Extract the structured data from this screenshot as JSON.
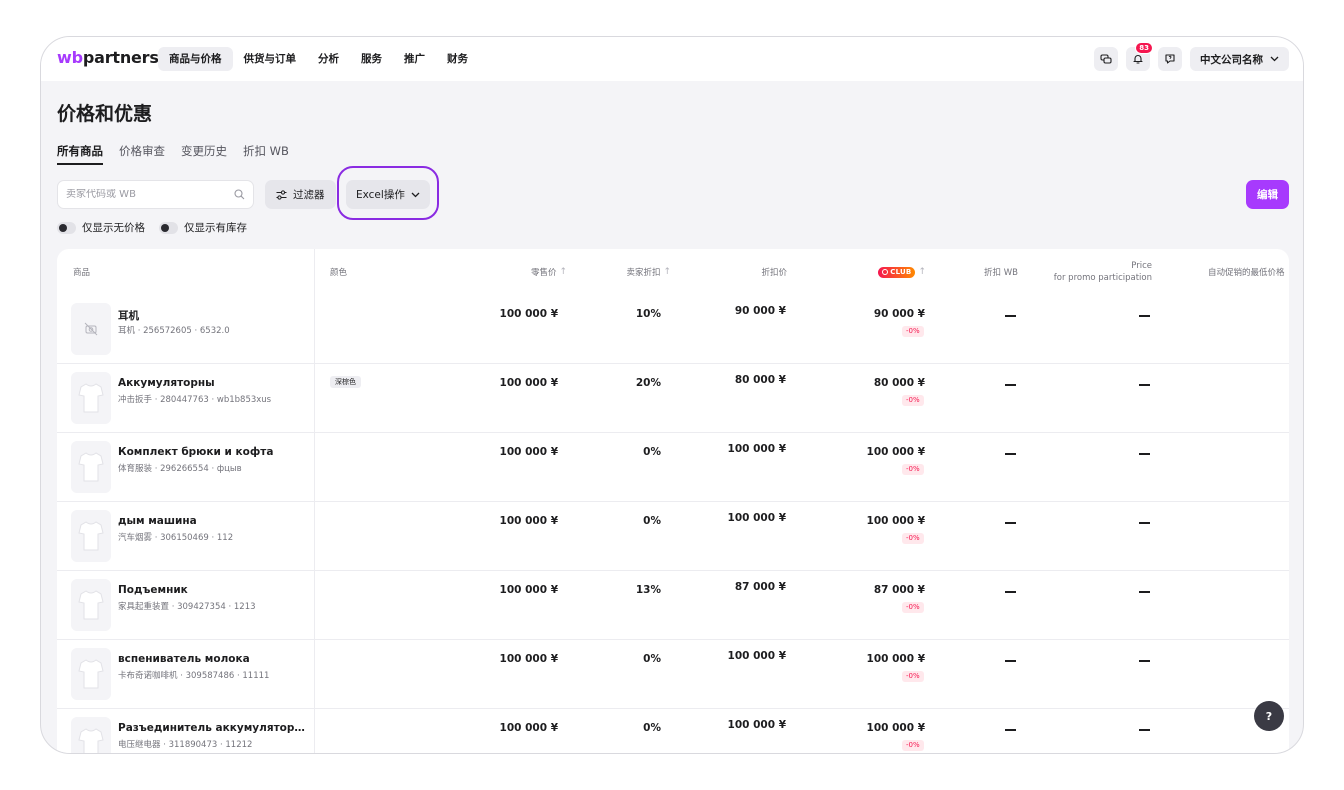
{
  "header": {
    "logo_prefix": "wb",
    "logo_suffix": "partners",
    "nav": [
      "商品与价格",
      "供货与订单",
      "分析",
      "服务",
      "推广",
      "财务"
    ],
    "notifications_count": "83",
    "company": "中文公司名称"
  },
  "page": {
    "title": "价格和优惠",
    "tabs": [
      "所有商品",
      "价格审查",
      "变更历史",
      "折扣 WB"
    ]
  },
  "toolbar": {
    "search_placeholder": "卖家代码或 WB",
    "filter_label": "过滤器",
    "excel_label": "Excel操作",
    "edit_label": "编辑"
  },
  "toggles": [
    "仅显示无价格",
    "仅显示有库存"
  ],
  "table": {
    "headers": {
      "product": "商品",
      "color": "颜色",
      "retail_price": "零售价",
      "seller_discount": "卖家折扣",
      "discount_price": "折扣价",
      "club_label": "CLUB",
      "wb_discount": "折扣 WB",
      "promo_price_line1": "Price",
      "promo_price_line2": "for promo participation",
      "auto_promo_min": "自动促销的最低价格"
    },
    "rows": [
      {
        "name": "耳机",
        "meta": "耳机 · 256572605 · 6532.0",
        "color": "",
        "price": "100 000 ¥",
        "discount": "10%",
        "disc_price": "90 000 ¥",
        "club_price": "90 000 ¥",
        "club_pct": "-0%"
      },
      {
        "name": "Аккумуляторны",
        "meta": "冲击扳手 · 280447763 · wb1b853xus",
        "color": "深棕色",
        "price": "100 000 ¥",
        "discount": "20%",
        "disc_price": "80 000 ¥",
        "club_price": "80 000 ¥",
        "club_pct": "-0%"
      },
      {
        "name": "Комплект брюки и кофта",
        "meta": "体育服装 · 296266554 · фцыв",
        "color": "",
        "price": "100 000 ¥",
        "discount": "0%",
        "disc_price": "100 000 ¥",
        "club_price": "100 000 ¥",
        "club_pct": "-0%"
      },
      {
        "name": "дым машина",
        "meta": "汽车烟雾 · 306150469 · 112",
        "color": "",
        "price": "100 000 ¥",
        "discount": "0%",
        "disc_price": "100 000 ¥",
        "club_price": "100 000 ¥",
        "club_pct": "-0%"
      },
      {
        "name": "Подъемник",
        "meta": "家具起重装置 · 309427354 · 1213",
        "color": "",
        "price": "100 000 ¥",
        "discount": "13%",
        "disc_price": "87 000 ¥",
        "club_price": "87 000 ¥",
        "club_pct": "-0%"
      },
      {
        "name": "вспениватель молока",
        "meta": "卡布奇诺咖啡机 · 309587486 · 11111",
        "color": "",
        "price": "100 000 ¥",
        "discount": "0%",
        "disc_price": "100 000 ¥",
        "club_price": "100 000 ¥",
        "club_pct": "-0%"
      },
      {
        "name": "Разъединитель аккумуляторно...",
        "meta": "电压继电器 · 311890473 · 11212",
        "color": "",
        "price": "100 000 ¥",
        "discount": "0%",
        "disc_price": "100 000 ¥",
        "club_price": "100 000 ¥",
        "club_pct": "-0%"
      }
    ]
  },
  "help_label": "?",
  "colors": {
    "accent": "#a73afd",
    "highlight_ring": "#8a2be2",
    "sale_red": "#f5164f"
  },
  "icons": [
    "bell-icon",
    "chat-icon",
    "support-icon",
    "search-icon",
    "filter-icon",
    "chevron-down-icon",
    "no-image-icon",
    "tshirt-icon"
  ]
}
